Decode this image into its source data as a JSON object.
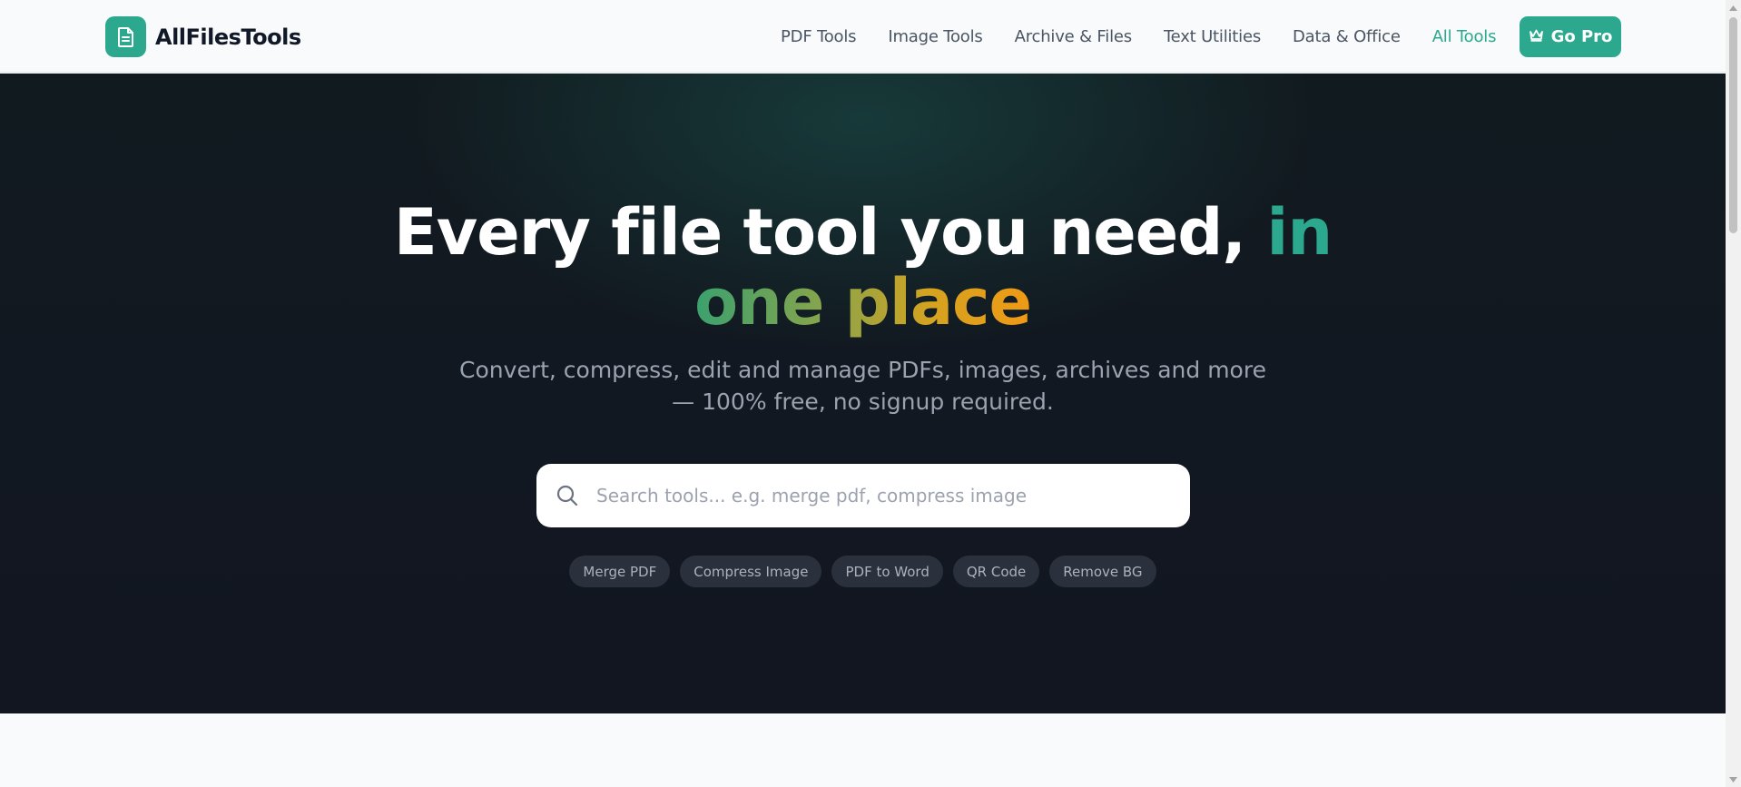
{
  "brand": {
    "name": "AllFilesTools",
    "icon": "file-text-icon",
    "color": "#2ba88e"
  },
  "nav": {
    "items": [
      {
        "label": "PDF Tools",
        "active": false
      },
      {
        "label": "Image Tools",
        "active": false
      },
      {
        "label": "Archive & Files",
        "active": false
      },
      {
        "label": "Text Utilities",
        "active": false
      },
      {
        "label": "Data & Office",
        "active": false
      },
      {
        "label": "All Tools",
        "active": true
      }
    ],
    "cta": {
      "label": "Go Pro",
      "icon": "crown-icon"
    }
  },
  "hero": {
    "title_main": "Every file tool you need,",
    "title_accent1": "in",
    "title_accent2": "one place",
    "subtitle_line1": "Convert, compress, edit and manage PDFs, images, archives and more",
    "subtitle_line2": "— 100% free, no signup required.",
    "search": {
      "placeholder": "Search tools... e.g. merge pdf, compress image",
      "value": "",
      "icon": "search-icon"
    },
    "quick_links": [
      "Merge PDF",
      "Compress Image",
      "PDF to Word",
      "QR Code",
      "Remove BG"
    ]
  },
  "colors": {
    "accent": "#2ba88e",
    "hero_bg": "#121821",
    "gradient_start": "#3aa16e",
    "gradient_end": "#f09a15"
  }
}
